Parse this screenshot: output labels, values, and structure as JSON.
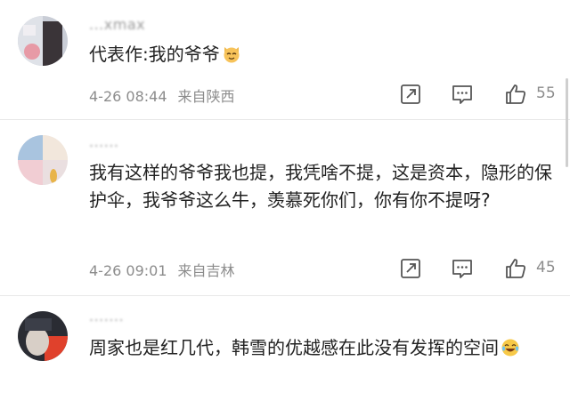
{
  "comments": [
    {
      "username": "...xmax",
      "text": "代表作:我的爷爷",
      "emoji": "cat-face-icon",
      "date": "4-26 08:44",
      "location": "来自陕西",
      "likes": "55"
    },
    {
      "username": "......",
      "text": "我有这样的爷爷我也提，我凭啥不提，这是资本，隐形的保护伞，我爷爷这么牛，羡慕死你们，你有你不提呀?",
      "date": "4-26 09:01",
      "location": "来自吉林",
      "likes": "45"
    },
    {
      "username": ".......",
      "text": "周家也是红几代，韩雪的优越感在此没有发挥的空间",
      "emoji": "laughing-tears-icon"
    }
  ],
  "colors": {
    "text": "#222222",
    "meta": "#8c8c8c",
    "icon": "#555555",
    "divider": "#e8e8e8"
  }
}
